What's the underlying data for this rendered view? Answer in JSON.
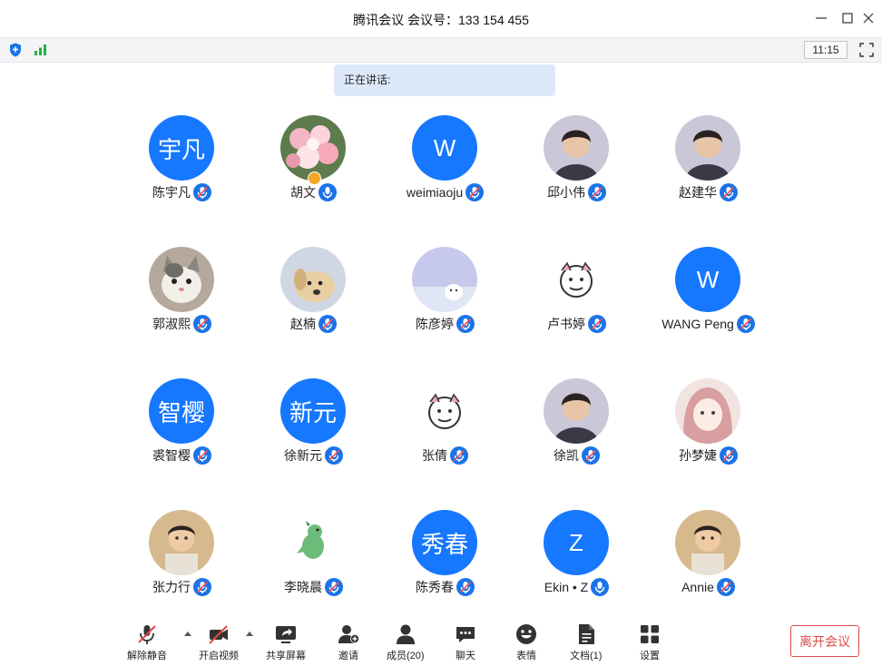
{
  "window": {
    "title": "腾讯会议 会议号：133 154 455",
    "controls": [
      "minimize-icon",
      "maximize-icon",
      "close-icon"
    ]
  },
  "statusbar": {
    "icons": [
      "shield-icon",
      "signal-bars-icon"
    ],
    "clock": "11:15",
    "fullscreen_icon": "fullscreen-icon"
  },
  "speaking": {
    "label": "正在讲话:"
  },
  "participants": [
    {
      "name": "陈宇凡",
      "avatar_text": "宇凡",
      "avatar_type": "text",
      "mic": "muted"
    },
    {
      "name": "胡文",
      "avatar_type": "photo",
      "avatar_desc": "flowers",
      "mic": "on",
      "host": true
    },
    {
      "name": "weimiaoju",
      "avatar_text": "W",
      "avatar_type": "text",
      "mic": "muted"
    },
    {
      "name": "邱小伟",
      "avatar_type": "photo",
      "avatar_desc": "person",
      "mic": "muted"
    },
    {
      "name": "赵建华",
      "avatar_type": "photo",
      "avatar_desc": "person",
      "mic": "muted"
    },
    {
      "name": "郭淑熙",
      "avatar_type": "photo",
      "avatar_desc": "cat",
      "mic": "muted"
    },
    {
      "name": "赵楠",
      "avatar_type": "photo",
      "avatar_desc": "dog",
      "mic": "muted"
    },
    {
      "name": "陈彦婷",
      "avatar_type": "photo",
      "avatar_desc": "illustration",
      "mic": "muted"
    },
    {
      "name": "卢书婷",
      "avatar_type": "photo",
      "avatar_desc": "cartoon",
      "mic": "muted"
    },
    {
      "name": "WANG Peng",
      "avatar_text": "W",
      "avatar_type": "text",
      "mic": "muted"
    },
    {
      "name": "裘智樱",
      "avatar_text": "智樱",
      "avatar_type": "text",
      "mic": "muted"
    },
    {
      "name": "徐新元",
      "avatar_text": "新元",
      "avatar_type": "text",
      "mic": "muted"
    },
    {
      "name": "张倩",
      "avatar_type": "photo",
      "avatar_desc": "cartoon",
      "mic": "muted"
    },
    {
      "name": "徐凯",
      "avatar_type": "photo",
      "avatar_desc": "person",
      "mic": "muted"
    },
    {
      "name": "孙梦婕",
      "avatar_type": "photo",
      "avatar_desc": "anime",
      "mic": "muted"
    },
    {
      "name": "张力行",
      "avatar_type": "photo",
      "avatar_desc": "child",
      "mic": "muted"
    },
    {
      "name": "李晓晨",
      "avatar_type": "photo",
      "avatar_desc": "dinosaur",
      "mic": "muted"
    },
    {
      "name": "陈秀春",
      "avatar_text": "秀春",
      "avatar_type": "text",
      "mic": "muted"
    },
    {
      "name": "Ekin • Z",
      "avatar_text": "Z",
      "avatar_type": "text",
      "mic": "on"
    },
    {
      "name": "Annie",
      "avatar_type": "photo",
      "avatar_desc": "child",
      "mic": "muted"
    }
  ],
  "toolbar": {
    "unmute": "解除静音",
    "video": "开启视频",
    "share": "共享屏幕",
    "invite": "邀请",
    "members": "成员(20)",
    "chat": "聊天",
    "reactions": "表情",
    "docs": "文档(1)",
    "settings": "设置",
    "leave": "离开会议"
  },
  "colors": {
    "accent": "#1677ff",
    "leave": "#e04a4a",
    "speaking_bg": "#dde9fb"
  }
}
